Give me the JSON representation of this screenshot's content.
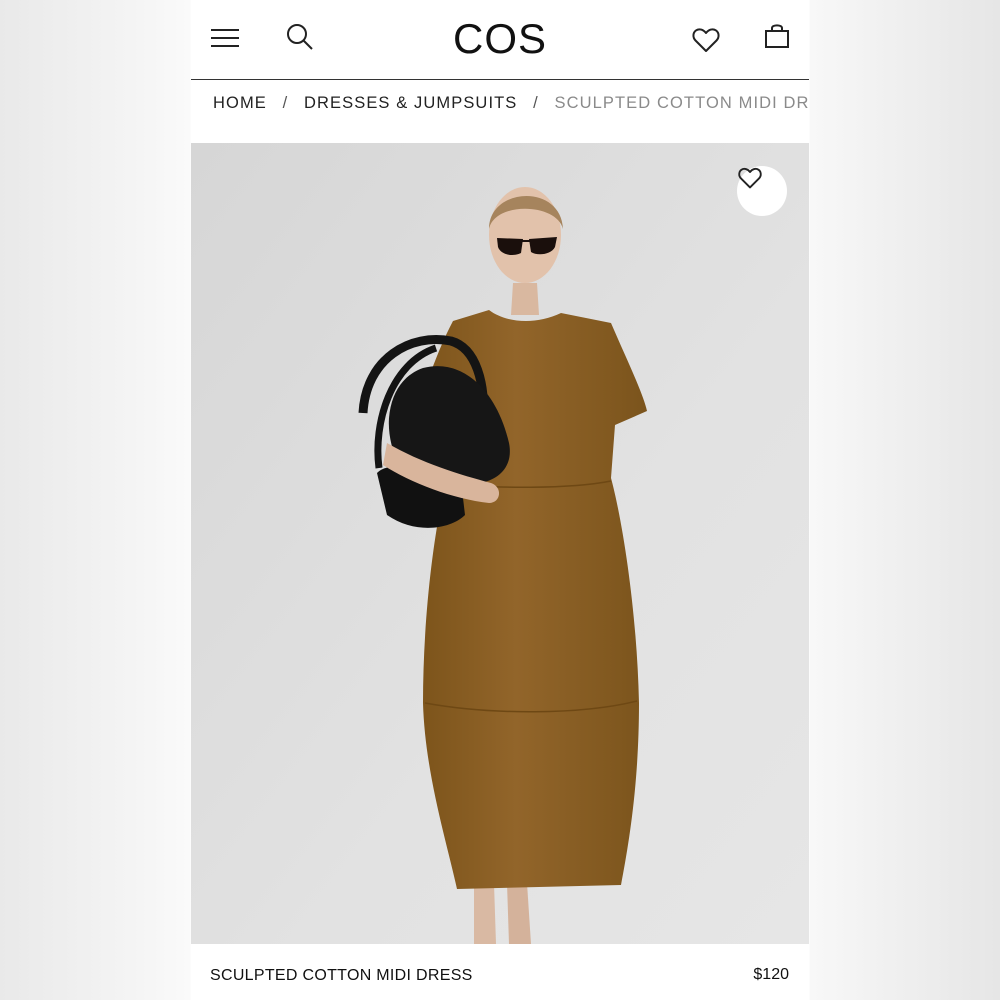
{
  "header": {
    "logo": "COS",
    "icons": {
      "menu": "hamburger-menu-icon",
      "search": "search-icon",
      "wishlist": "heart-icon",
      "bag": "shopping-bag-icon"
    }
  },
  "breadcrumb": {
    "items": [
      "HOME",
      "DRESSES & JUMPSUITS",
      "SCULPTED COTTON MIDI DRESS"
    ],
    "separator": "/"
  },
  "product": {
    "name": "SCULPTED COTTON MIDI DRESS",
    "price": "$120",
    "image_alt": "Model wearing brown sculpted cotton midi dress holding a black leather bag",
    "wishlist_icon": "heart-icon"
  },
  "colors": {
    "dress": "#8a5f22",
    "background": "#e0e0e0",
    "bag": "#141414",
    "text": "#111111",
    "breadcrumb_current": "#8a8a8a"
  }
}
